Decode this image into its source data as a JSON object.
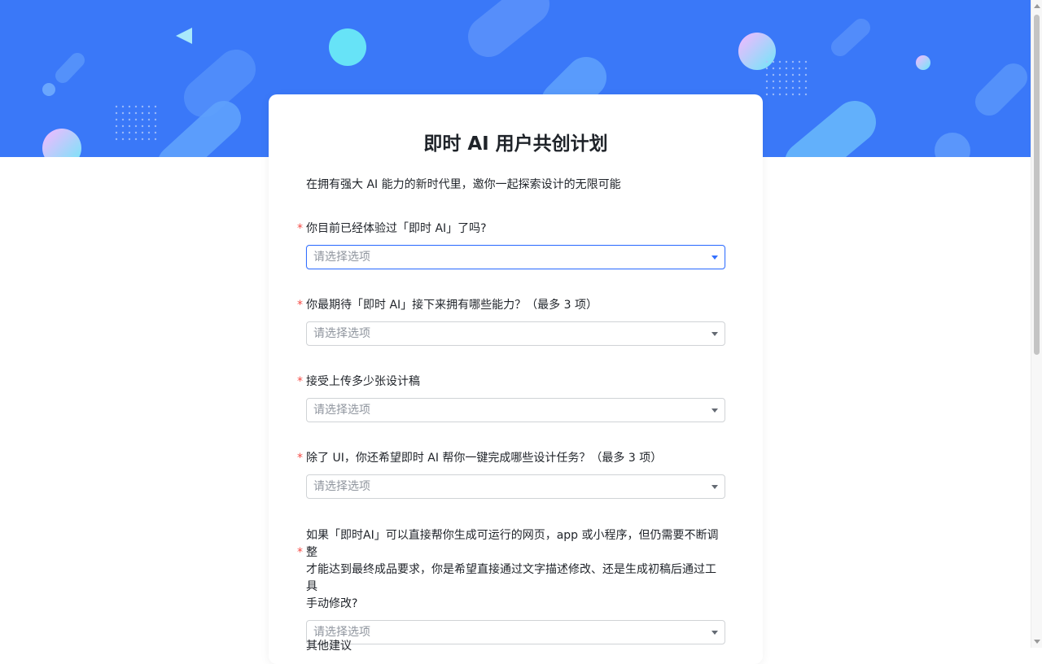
{
  "form": {
    "title": "即时 AI 用户共创计划",
    "subtitle": "在拥有强大 AI 能力的新时代里，邀你一起探索设计的无限可能",
    "required_mark": "*",
    "questions": [
      {
        "label": "你目前已经体验过「即时 AI」了吗?",
        "placeholder": "请选择选项",
        "required": true,
        "focused": true
      },
      {
        "label": "你最期待「即时 AI」接下来拥有哪些能力？（最多 3 项）",
        "placeholder": "请选择选项",
        "required": true
      },
      {
        "label": "接受上传多少张设计稿",
        "placeholder": "请选择选项",
        "required": true
      },
      {
        "label": "除了 UI，你还希望即时 AI 帮你一键完成哪些设计任务？（最多 3 项）",
        "placeholder": "请选择选项",
        "required": true
      },
      {
        "label_lines": [
          "如果「即时AI」可以直接帮你生成可运行的网页，app 或小程序，但仍需要不断调整",
          "才能达到最终成品要求，你是希望直接通过文字描述修改、还是生成初稿后通过工具",
          "手动修改?"
        ],
        "placeholder": "请选择选项",
        "required": true
      },
      {
        "label": "其他建议",
        "required": false
      }
    ]
  },
  "colors": {
    "hero": "#3a78f8",
    "accent": "#3370ff",
    "required": "#f54a45"
  }
}
